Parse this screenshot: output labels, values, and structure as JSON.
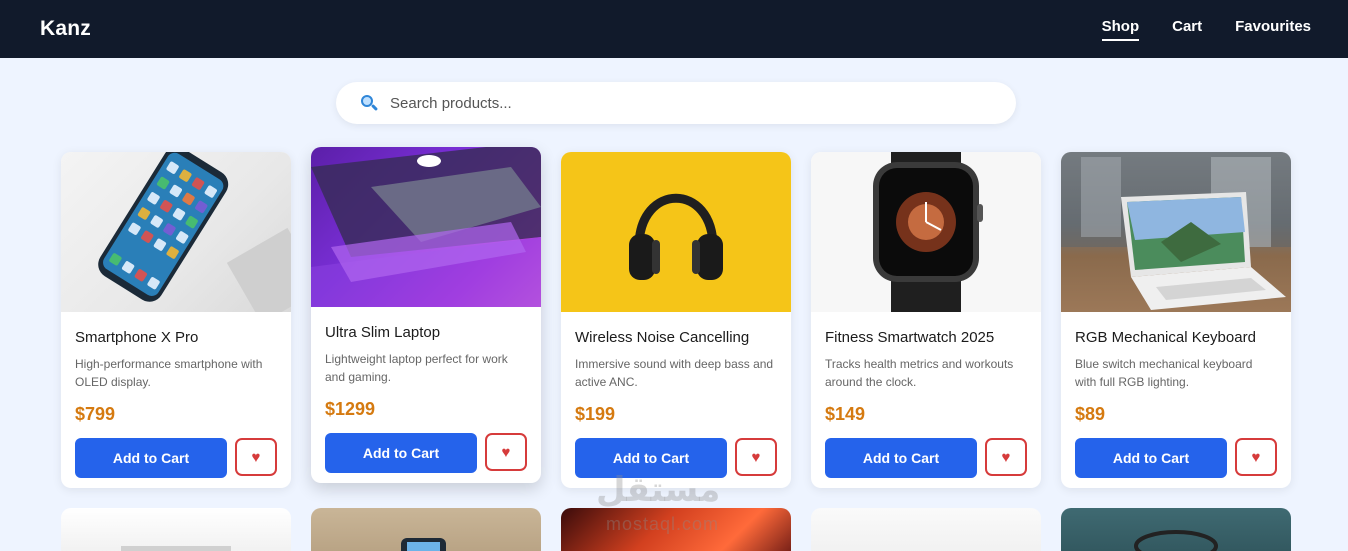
{
  "nav": {
    "brand": "Kanz",
    "links": [
      {
        "label": "Shop",
        "active": true
      },
      {
        "label": "Cart",
        "active": false
      },
      {
        "label": "Favourites",
        "active": false
      }
    ]
  },
  "search": {
    "placeholder": "Search products...",
    "icon": "search-icon"
  },
  "products": [
    {
      "name": "Smartphone X Pro",
      "description": "High-performance smartphone with OLED display.",
      "price": "$799",
      "add_label": "Add to Cart",
      "fav_icon": "♥"
    },
    {
      "name": "Ultra Slim Laptop",
      "description": "Lightweight laptop perfect for work and gaming.",
      "price": "$1299",
      "add_label": "Add to Cart",
      "fav_icon": "♥"
    },
    {
      "name": "Wireless Noise Cancelling",
      "description": "Immersive sound with deep bass and active ANC.",
      "price": "$199",
      "add_label": "Add to Cart",
      "fav_icon": "♥"
    },
    {
      "name": "Fitness Smartwatch 2025",
      "description": "Tracks health metrics and workouts around the clock.",
      "price": "$149",
      "add_label": "Add to Cart",
      "fav_icon": "♥"
    },
    {
      "name": "RGB Mechanical Keyboard",
      "description": "Blue switch mechanical keyboard with full RGB lighting.",
      "price": "$89",
      "add_label": "Add to Cart",
      "fav_icon": "♥"
    }
  ],
  "watermark": {
    "text": "مستقل",
    "sub": "mostaql.com"
  },
  "colors": {
    "navbar": "#111a2b",
    "accent": "#2563eb",
    "price": "#d57a10",
    "favourite": "#d63b3b",
    "background": "#eef4ff"
  }
}
